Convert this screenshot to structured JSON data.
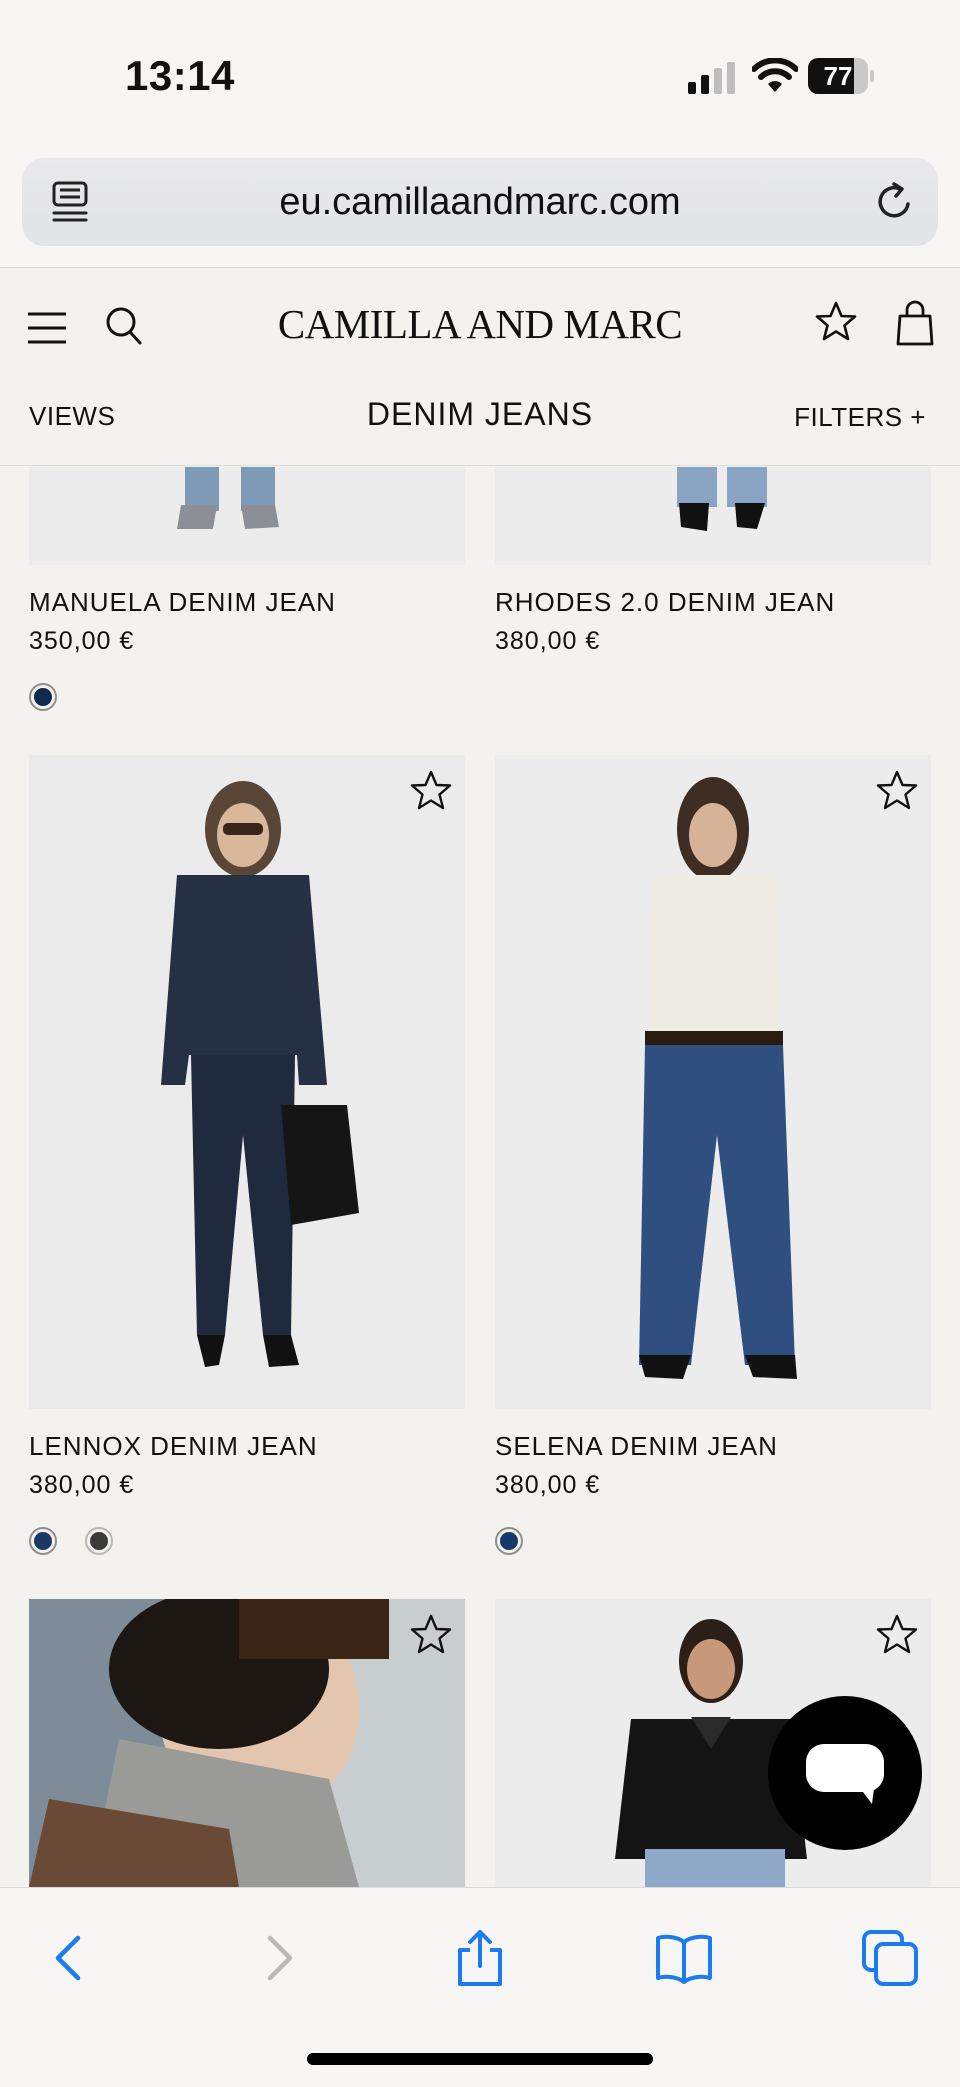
{
  "status_bar": {
    "time": "13:14",
    "battery_level": "77",
    "battery_fraction": 0.77
  },
  "browser": {
    "url": "eu.camillaandmarc.com"
  },
  "header": {
    "logo": "CAMILLA AND MARC",
    "views_label": "VIEWS",
    "category_title": "DENIM JEANS",
    "filters_label": "FILTERS +"
  },
  "products": [
    {
      "name": "MANUELA DENIM JEAN",
      "price": "350,00 €",
      "swatches": [
        "#0f2a4d"
      ],
      "wishlist_icon": "star-icon"
    },
    {
      "name": "RHODES 2.0 DENIM JEAN",
      "price": "380,00 €",
      "swatches": [],
      "wishlist_icon": "star-icon"
    },
    {
      "name": "LENNOX DENIM JEAN",
      "price": "380,00 €",
      "swatches": [
        "#1a3a63",
        "#3a3a3a"
      ],
      "wishlist_icon": "star-icon"
    },
    {
      "name": "SELENA DENIM JEAN",
      "price": "380,00 €",
      "swatches": [
        "#173a6a"
      ],
      "wishlist_icon": "star-icon"
    },
    {
      "name": "",
      "price": "",
      "swatches": [],
      "wishlist_icon": "star-icon"
    },
    {
      "name": "",
      "price": "",
      "swatches": [],
      "wishlist_icon": "star-icon"
    }
  ],
  "icons": {
    "menu": "hamburger-icon",
    "search": "search-icon",
    "wishlist": "star-icon",
    "bag": "shopping-bag-icon",
    "chat": "chat-bubble-icon",
    "back": "back-arrow-icon",
    "forward": "forward-arrow-icon",
    "share": "share-icon",
    "bookmarks": "book-icon",
    "tabs": "tabs-icon"
  },
  "colors": {
    "accent": "#1a7cf0",
    "background": "#f3f2ef",
    "text": "#111111"
  }
}
